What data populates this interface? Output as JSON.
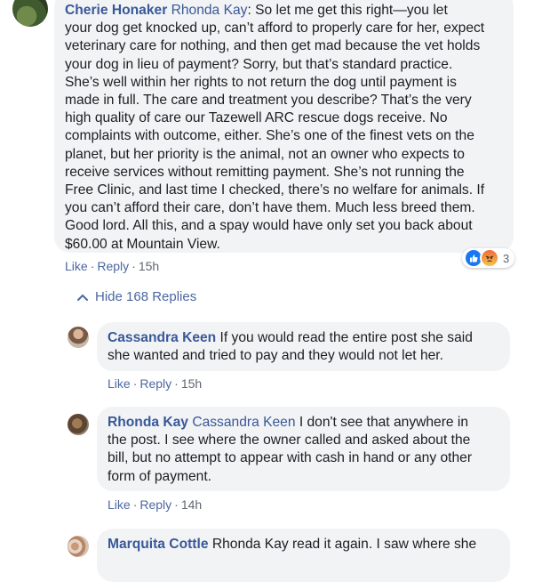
{
  "colors": {
    "link_blue": "#385898",
    "bubble_bg": "#f2f3f5",
    "like_blue": "#1877f2",
    "angry_orange": "#f4a23b"
  },
  "comment1": {
    "author": "Cherie Honaker",
    "tagged": "Rhonda Kay",
    "lines": [
      ": So let me get this right—you let",
      "your dog get knocked up, can’t afford to properly care for her, expect",
      "veterinary care for nothing, and then get mad because the vet holds",
      "your dog in lieu of payment? Sorry, but that’s standard practice.",
      "She’s well within her rights to not return the dog until payment is",
      "made in full. The care and treatment you describe? That’s the very",
      "high quality of care our Tazewell ARC rescue dogs receive. No",
      "complaints with outcome, either. She’s one of the finest vets on the",
      "planet, but her priority is the animal, not an owner who expects to",
      "receive services without remitting payment. She’s not running the",
      "Free Clinic, and last time I checked, there’s no welfare for animals. If",
      "you can’t afford their care, don’t have them. Much less breed them.",
      "Good lord. All this, and a spay would have only set you back about",
      "$60.00 at Mountain View."
    ],
    "like": "Like",
    "reply": "Reply",
    "time": "15h",
    "reaction_icons": [
      "like-icon",
      "angry-icon"
    ],
    "reaction_count": "3"
  },
  "hide_replies": "Hide 168 Replies",
  "reply1": {
    "author": "Cassandra Keen",
    "lines": [
      " If you would read the entire post she said",
      "she wanted and tried to pay and they would not let her."
    ],
    "like": "Like",
    "reply": "Reply",
    "time": "15h"
  },
  "reply2": {
    "author": "Rhonda Kay",
    "tagged": "Cassandra Keen",
    "lines": [
      " I don't see that anywhere in",
      "the post. I see where the owner called and asked about the",
      "bill, but no attempt to appear with cash in hand or any other",
      "form of payment."
    ],
    "like": "Like",
    "reply": "Reply",
    "time": "14h"
  },
  "reply3": {
    "author": "Marquita Cottle",
    "text": " Rhonda Kay read it again. I saw where she"
  }
}
